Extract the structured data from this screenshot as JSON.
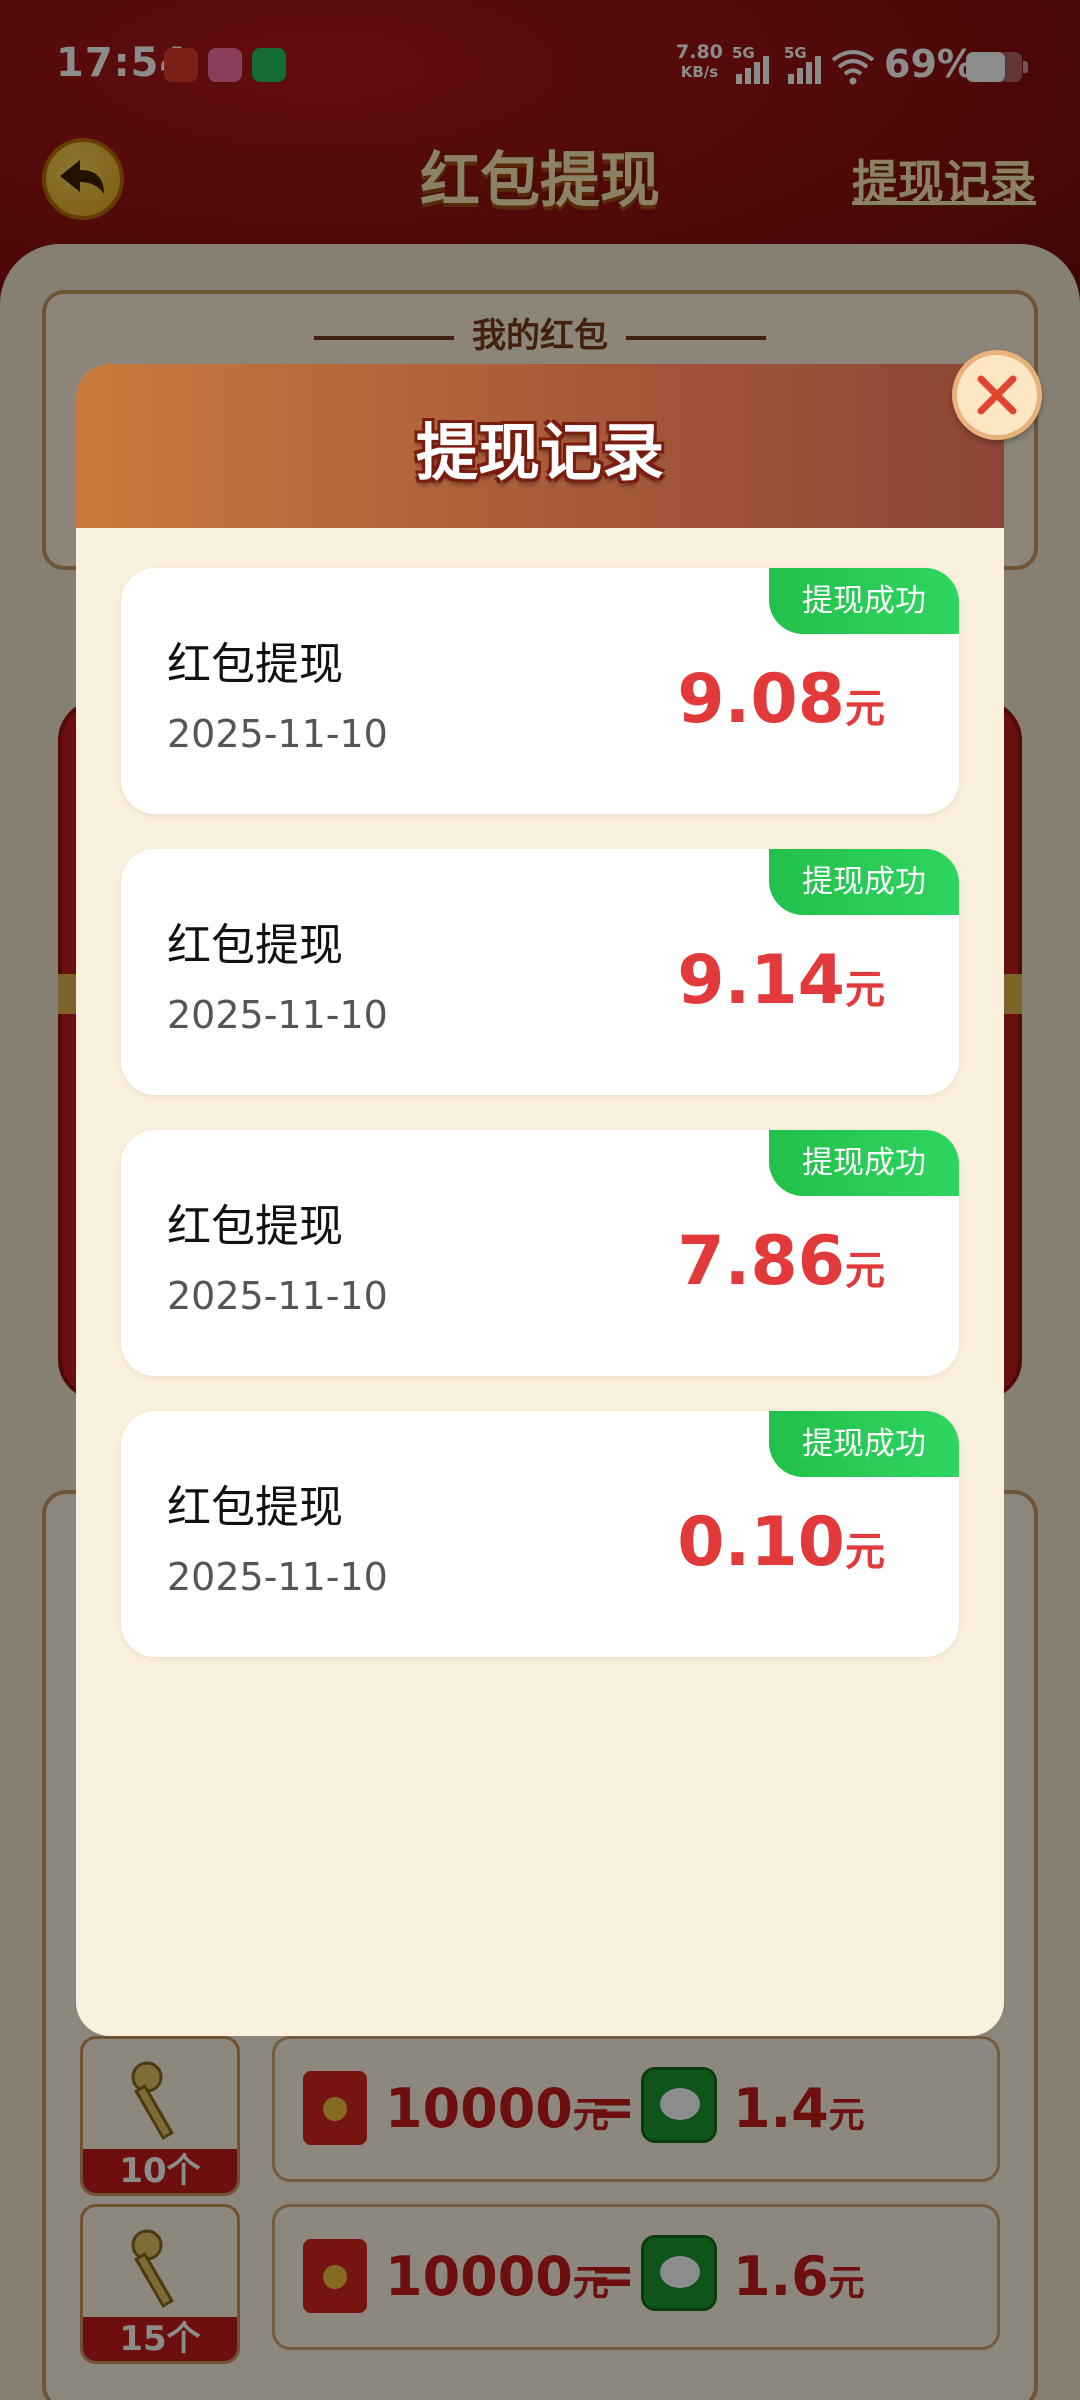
{
  "status_bar": {
    "time": "17:54",
    "speed_value": "7.80",
    "speed_unit": "KB/s",
    "sim1_label": "5G",
    "sim2_label": "5G",
    "battery_text": "69%",
    "battery_level": 0.69
  },
  "header": {
    "title": "红包提现",
    "record_link": "提现记录"
  },
  "panel": {
    "subtitle": "我的红包"
  },
  "exchange_rows": [
    {
      "key_count": "10个",
      "amount": "10000",
      "amount_unit": "元",
      "equals": "=",
      "cash": "1.4",
      "cash_unit": "元"
    },
    {
      "key_count": "15个",
      "amount": "10000",
      "amount_unit": "元",
      "equals": "=",
      "cash": "1.6",
      "cash_unit": "元"
    }
  ],
  "modal": {
    "title": "提现记录",
    "records": [
      {
        "title": "红包提现",
        "date": "2025-11-10",
        "amount": "9.08",
        "unit": "元",
        "status": "提现成功"
      },
      {
        "title": "红包提现",
        "date": "2025-11-10",
        "amount": "9.14",
        "unit": "元",
        "status": "提现成功"
      },
      {
        "title": "红包提现",
        "date": "2025-11-10",
        "amount": "7.86",
        "unit": "元",
        "status": "提现成功"
      },
      {
        "title": "红包提现",
        "date": "2025-11-10",
        "amount": "0.10",
        "unit": "元",
        "status": "提现成功"
      }
    ]
  },
  "colors": {
    "accent_red": "#e23a3a",
    "success_green": "#22c04a",
    "header_brown": "#a65a3a"
  }
}
